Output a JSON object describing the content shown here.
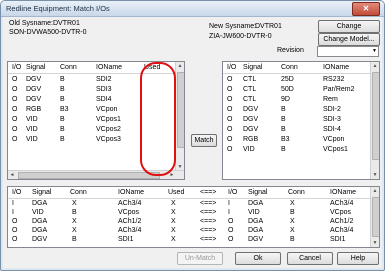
{
  "window": {
    "title": "Redline Equipment: Match I/Os",
    "close_glyph": "✕"
  },
  "header": {
    "old_sysname_label": "Old Sysname:",
    "old_sysname_value": "DVTR01",
    "old_model": "SON-DVWA500-DVTR-0",
    "new_sysname_label": "New Sysname:",
    "new_sysname_value": "DVTR01",
    "new_model": "ZIA-JW600-DVTR-0",
    "change_sysname_button": "Change Sysname...",
    "change_model_button": "Change Model...",
    "revision_label": "Revision",
    "revision_value": ""
  },
  "old_io_table": {
    "columns": [
      "I/O",
      "Signal",
      "Conn",
      "IOName",
      "Used"
    ],
    "rows": [
      [
        "O",
        "DGV",
        "B",
        "SDI2",
        ""
      ],
      [
        "O",
        "DGV",
        "B",
        "SDI3",
        ""
      ],
      [
        "O",
        "DGV",
        "B",
        "SDI4",
        ""
      ],
      [
        "O",
        "RGB",
        "B3",
        "VCpon",
        ""
      ],
      [
        "O",
        "VID",
        "B",
        "VCpos1",
        ""
      ],
      [
        "O",
        "VID",
        "B",
        "VCpos2",
        ""
      ],
      [
        "O",
        "VID",
        "B",
        "VCpos3",
        ""
      ]
    ]
  },
  "new_io_table": {
    "columns": [
      "I/O",
      "Signal",
      "Conn",
      "IOName"
    ],
    "rows": [
      [
        "O",
        "CTL",
        "25D",
        "RS232"
      ],
      [
        "O",
        "CTL",
        "50D",
        "Par/Rem2"
      ],
      [
        "O",
        "CTL",
        "9D",
        "Rem"
      ],
      [
        "O",
        "DGV",
        "B",
        "SDI-2"
      ],
      [
        "O",
        "DGV",
        "B",
        "SDI-3"
      ],
      [
        "O",
        "DGV",
        "B",
        "SDI-4"
      ],
      [
        "O",
        "RGB",
        "B3",
        "VCpon"
      ],
      [
        "O",
        "VID",
        "B",
        "VCpos1"
      ]
    ]
  },
  "match_button": "Match",
  "matched_table": {
    "columns": [
      "I/O",
      "Signal",
      "Conn",
      "IOName",
      "Used",
      "<==>",
      "I/O",
      "Signal",
      "Conn",
      "IOName"
    ],
    "rows": [
      [
        "I",
        "DGA",
        "X",
        "ACh3/4",
        "X",
        "<==>",
        "I",
        "DGA",
        "X",
        "ACh3/4"
      ],
      [
        "I",
        "VID",
        "B",
        "VCpos",
        "X",
        "<==>",
        "I",
        "VID",
        "B",
        "VCpos"
      ],
      [
        "O",
        "DGA",
        "X",
        "ACh1/2",
        "X",
        "<==>",
        "O",
        "DGA",
        "X",
        "ACh1/2"
      ],
      [
        "O",
        "DGA",
        "X",
        "ACh3/4",
        "X",
        "<==>",
        "O",
        "DGA",
        "X",
        "ACh3/4"
      ],
      [
        "O",
        "DGV",
        "B",
        "SDI1",
        "X",
        "<==>",
        "O",
        "DGV",
        "B",
        "SDI1"
      ]
    ]
  },
  "footer": {
    "unmatch_button": "Un-Match",
    "ok_button": "Ok",
    "cancel_button": "Cancel",
    "help_button": "Help"
  },
  "glyphs": {
    "up": "▲",
    "down": "▼",
    "left": "◄",
    "right": "►",
    "combo_arrow": "▼",
    "grip": "≡"
  }
}
